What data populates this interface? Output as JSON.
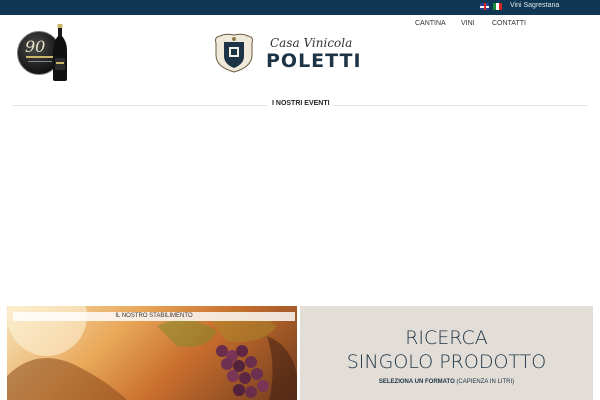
{
  "topbar": {
    "flags": [
      {
        "icon": "uk-flag-icon",
        "language": "English"
      },
      {
        "icon": "italy-flag-icon",
        "language": "Italiano"
      }
    ],
    "link": "Vini Sagrestana",
    "color": "#0f3652"
  },
  "header": {
    "badge": {
      "number": "90",
      "icon": "anniversary-badge-icon"
    },
    "bottle_icon": "wine-bottle-icon",
    "crest_icon": "winery-crest-icon",
    "logo_script": "Casa Vinicola",
    "logo_main": "POLETTI"
  },
  "nav": {
    "items": [
      {
        "label": "CANTINA"
      },
      {
        "label": "VINI"
      },
      {
        "label": "CONTATTI"
      }
    ]
  },
  "events": {
    "title": "I NOSTRI EVENTI"
  },
  "facility": {
    "label": "IL NOSTRO STABILIMENTO"
  },
  "search": {
    "title": "RICERCA\nSINGOLO PRODOTTO",
    "subtitle_strong": "SELEZIONA UN FORMATO",
    "subtitle_rest": " (CAPIENZA IN LITRI)",
    "background": "#e2ddd6",
    "accent": "#1d3446"
  }
}
